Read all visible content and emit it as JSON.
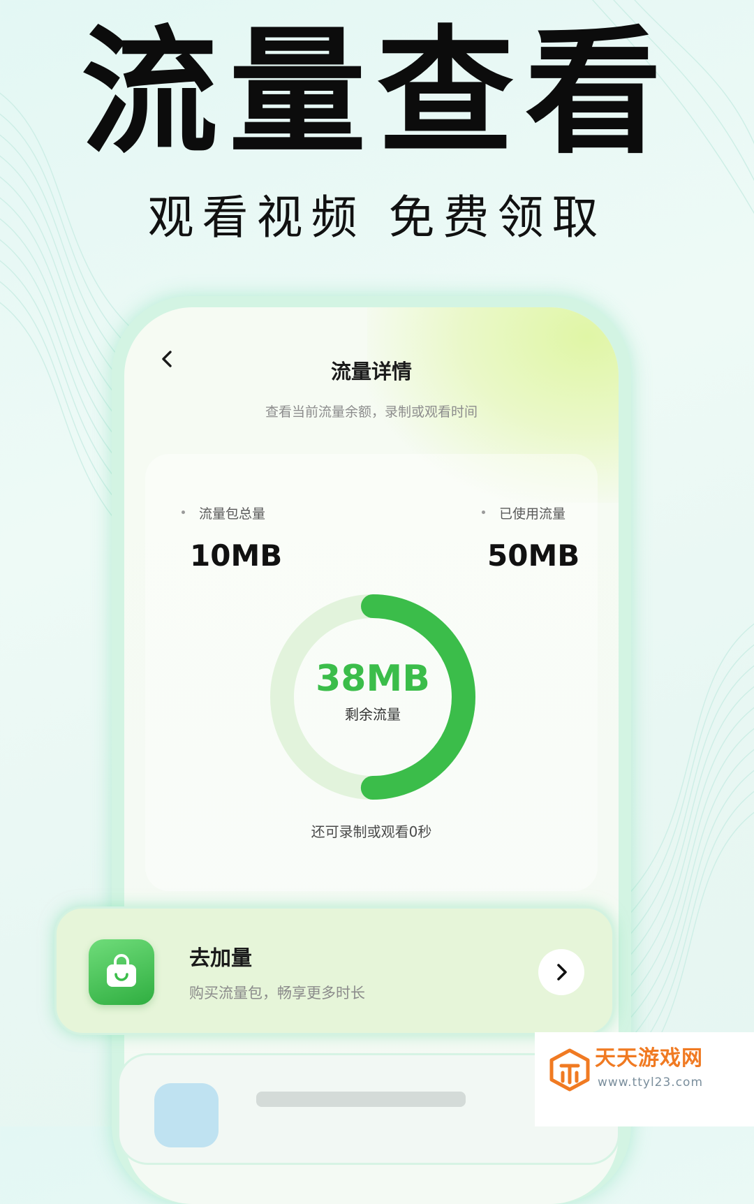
{
  "hero": {
    "title": "流量查看",
    "subtitle": "观看视频 免费领取"
  },
  "screen": {
    "back_icon": "chevron-left-icon",
    "title": "流量详情",
    "subtitle": "查看当前流量余额，录制或观看时间",
    "total_label": "流量包总量",
    "total_value": "10MB",
    "used_label": "已使用流量",
    "used_value": "50MB",
    "remaining_value": "38MB",
    "remaining_label": "剩余流量",
    "remaining_fraction": 0.5,
    "note": "还可录制或观看0秒"
  },
  "add_card": {
    "icon": "shopping-bag-icon",
    "title": "去加量",
    "description": "购买流量包，畅享更多时长",
    "arrow_icon": "chevron-right-icon"
  },
  "watermark": {
    "name": "天天游戏网",
    "url": "www.ttyl23.com"
  },
  "colors": {
    "accent_green": "#3bbd4a",
    "ring_track": "#e2f3dc",
    "watermark_orange": "#f07a22"
  }
}
